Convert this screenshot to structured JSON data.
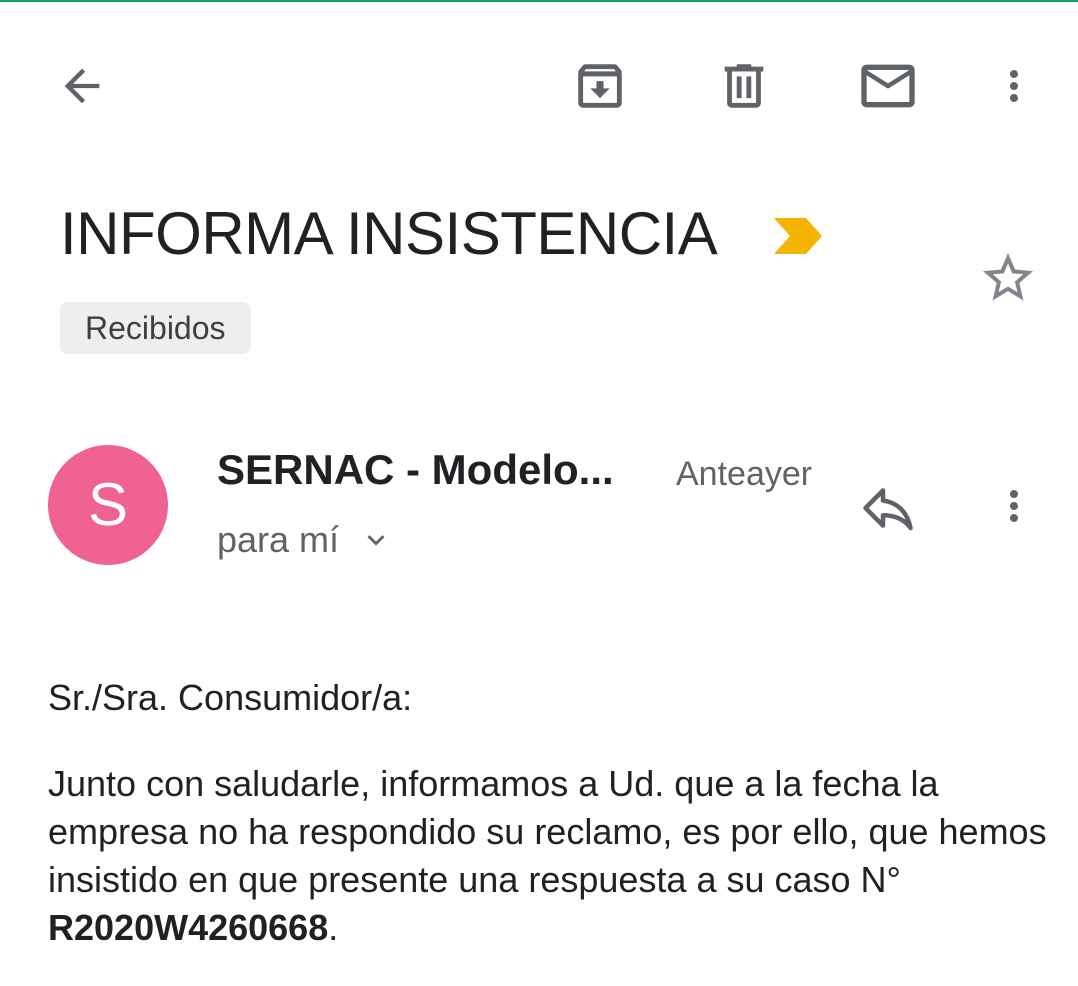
{
  "toolbar": {
    "back_icon": "arrow-back-icon",
    "archive_icon": "archive-icon",
    "delete_icon": "trash-icon",
    "mark_unread_icon": "mail-icon",
    "more_icon": "more-vert-icon"
  },
  "email": {
    "subject": "INFORMA INSISTENCIA",
    "importance_color": "#f4b400",
    "label": "Recibidos",
    "sender_initial": "S",
    "sender_name": "SERNAC - Modelo...",
    "date": "Anteayer",
    "recipient": "para mí",
    "avatar_color": "#f06292"
  },
  "body": {
    "greeting": "Sr./Sra. Consumidor/a:",
    "paragraph": "Junto con saludarle, informamos a Ud. que a la fecha la empresa no ha respondido su reclamo, es por ello, que hemos insistido en que presente una respuesta a su caso N°",
    "case_number": "R2020W4260668",
    "end_punct": "."
  },
  "colors": {
    "icon": "#5f6368",
    "text": "#202124",
    "accent_bar": "#1aa260"
  }
}
